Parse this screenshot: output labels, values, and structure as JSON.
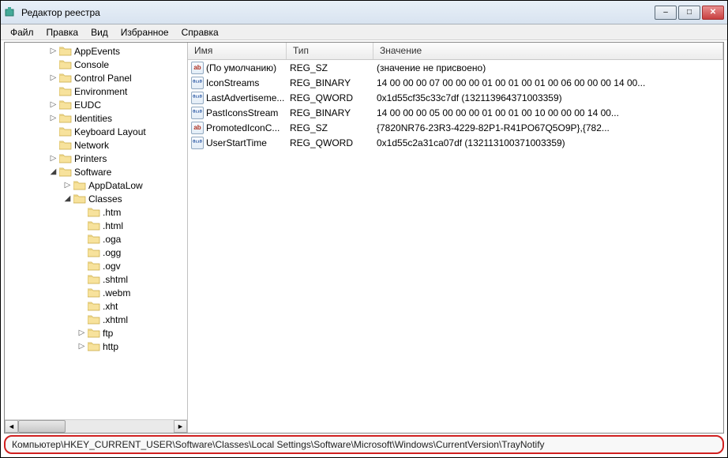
{
  "window": {
    "title": "Редактор реестра",
    "buttons": {
      "min": "–",
      "max": "□",
      "close": "✕"
    }
  },
  "menu": [
    "Файл",
    "Правка",
    "Вид",
    "Избранное",
    "Справка"
  ],
  "tree": [
    {
      "depth": 0,
      "expand": ">",
      "label": "AppEvents"
    },
    {
      "depth": 0,
      "expand": " ",
      "label": "Console"
    },
    {
      "depth": 0,
      "expand": ">",
      "label": "Control Panel"
    },
    {
      "depth": 0,
      "expand": " ",
      "label": "Environment"
    },
    {
      "depth": 0,
      "expand": ">",
      "label": "EUDC"
    },
    {
      "depth": 0,
      "expand": ">",
      "label": "Identities"
    },
    {
      "depth": 0,
      "expand": " ",
      "label": "Keyboard Layout"
    },
    {
      "depth": 0,
      "expand": " ",
      "label": "Network"
    },
    {
      "depth": 0,
      "expand": ">",
      "label": "Printers"
    },
    {
      "depth": 0,
      "expand": "v",
      "label": "Software"
    },
    {
      "depth": 1,
      "expand": ">",
      "label": "AppDataLow"
    },
    {
      "depth": 1,
      "expand": "v",
      "label": "Classes"
    },
    {
      "depth": 2,
      "expand": " ",
      "label": ".htm"
    },
    {
      "depth": 2,
      "expand": " ",
      "label": ".html"
    },
    {
      "depth": 2,
      "expand": " ",
      "label": ".oga"
    },
    {
      "depth": 2,
      "expand": " ",
      "label": ".ogg"
    },
    {
      "depth": 2,
      "expand": " ",
      "label": ".ogv"
    },
    {
      "depth": 2,
      "expand": " ",
      "label": ".shtml"
    },
    {
      "depth": 2,
      "expand": " ",
      "label": ".webm"
    },
    {
      "depth": 2,
      "expand": " ",
      "label": ".xht"
    },
    {
      "depth": 2,
      "expand": " ",
      "label": ".xhtml"
    },
    {
      "depth": 2,
      "expand": ">",
      "label": "ftp"
    },
    {
      "depth": 2,
      "expand": ">",
      "label": "http"
    }
  ],
  "columns": {
    "name": "Имя",
    "type": "Тип",
    "value": "Значение"
  },
  "rows": [
    {
      "icon": "str",
      "name": "(По умолчанию)",
      "type": "REG_SZ",
      "value": "(значение не присвоено)"
    },
    {
      "icon": "bin",
      "name": "IconStreams",
      "type": "REG_BINARY",
      "value": "14 00 00 00 07 00 00 00 01 00 01 00 01 00 06 00 00 00 14 00..."
    },
    {
      "icon": "bin",
      "name": "LastAdvertiseme...",
      "type": "REG_QWORD",
      "value": "0x1d55cf35c33c7df (132113964371003359)"
    },
    {
      "icon": "bin",
      "name": "PastIconsStream",
      "type": "REG_BINARY",
      "value": "14 00 00 00 05 00 00 00 01 00 01 00 10 00 00 00 14 00..."
    },
    {
      "icon": "str",
      "name": "PromotedIconC...",
      "type": "REG_SZ",
      "value": "{7820NR76-23R3-4229-82P1-R41PO67Q5O9P},{782..."
    },
    {
      "icon": "bin",
      "name": "UserStartTime",
      "type": "REG_QWORD",
      "value": "0x1d55c2a31ca07df (132113100371003359)"
    }
  ],
  "status": "Компьютер\\HKEY_CURRENT_USER\\Software\\Classes\\Local Settings\\Software\\Microsoft\\Windows\\CurrentVersion\\TrayNotify",
  "icon_labels": {
    "str": "ab",
    "bin": "011\n110"
  }
}
